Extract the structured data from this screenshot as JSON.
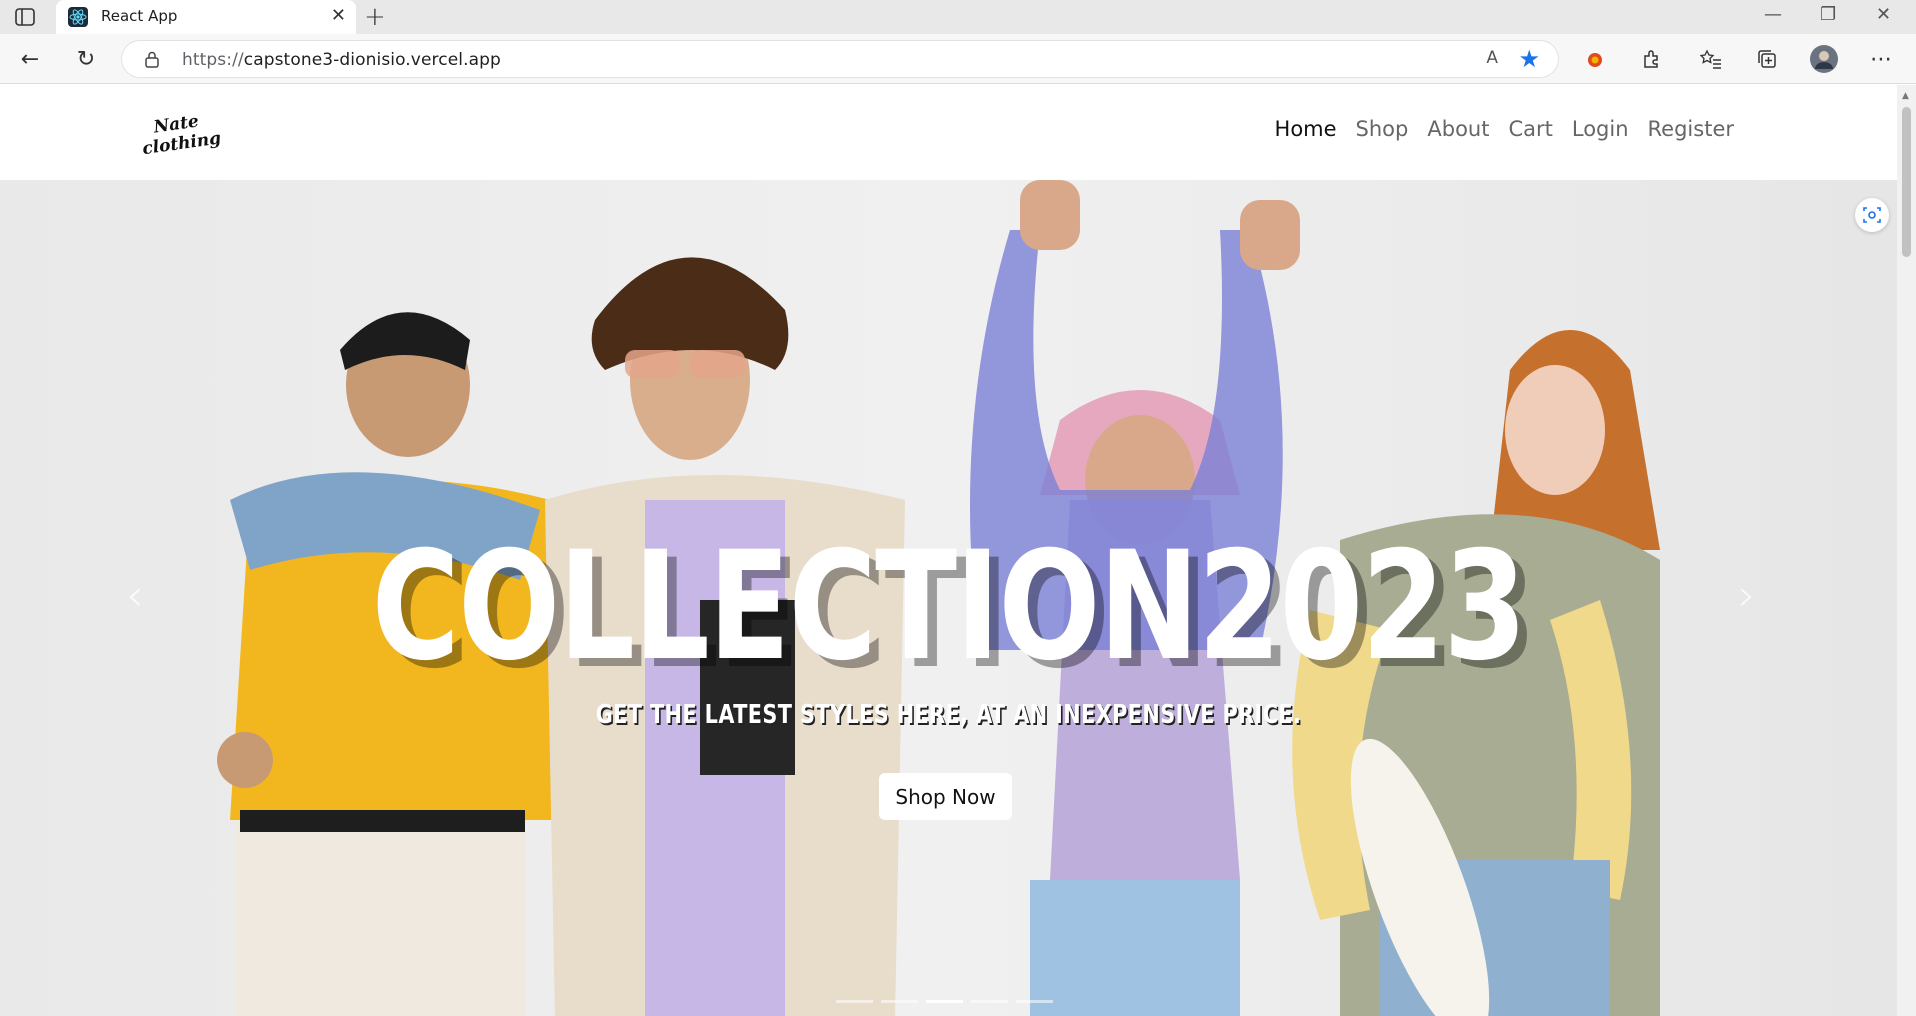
{
  "browser": {
    "tab_title": "React App",
    "url_scheme": "https://",
    "url_host": "capstone3-dionisio.vercel.app",
    "read_aloud": "A",
    "window_controls": [
      "—",
      "❐",
      "✕"
    ]
  },
  "site": {
    "logo_text": "Nate clothing",
    "nav": [
      "Home",
      "Shop",
      "About",
      "Cart",
      "Login",
      "Register"
    ],
    "active_nav": "Home"
  },
  "hero": {
    "headline": "COLLECTION2023",
    "subline": "GET THE LATEST STYLES HERE, AT AN INEXPENSIVE PRICE.",
    "cta": "Shop Now",
    "slides": 5,
    "active_slide": 3
  },
  "colors": {
    "accent": "#1a73e8",
    "nav_active": "#111111",
    "nav_inactive": "#666666"
  }
}
